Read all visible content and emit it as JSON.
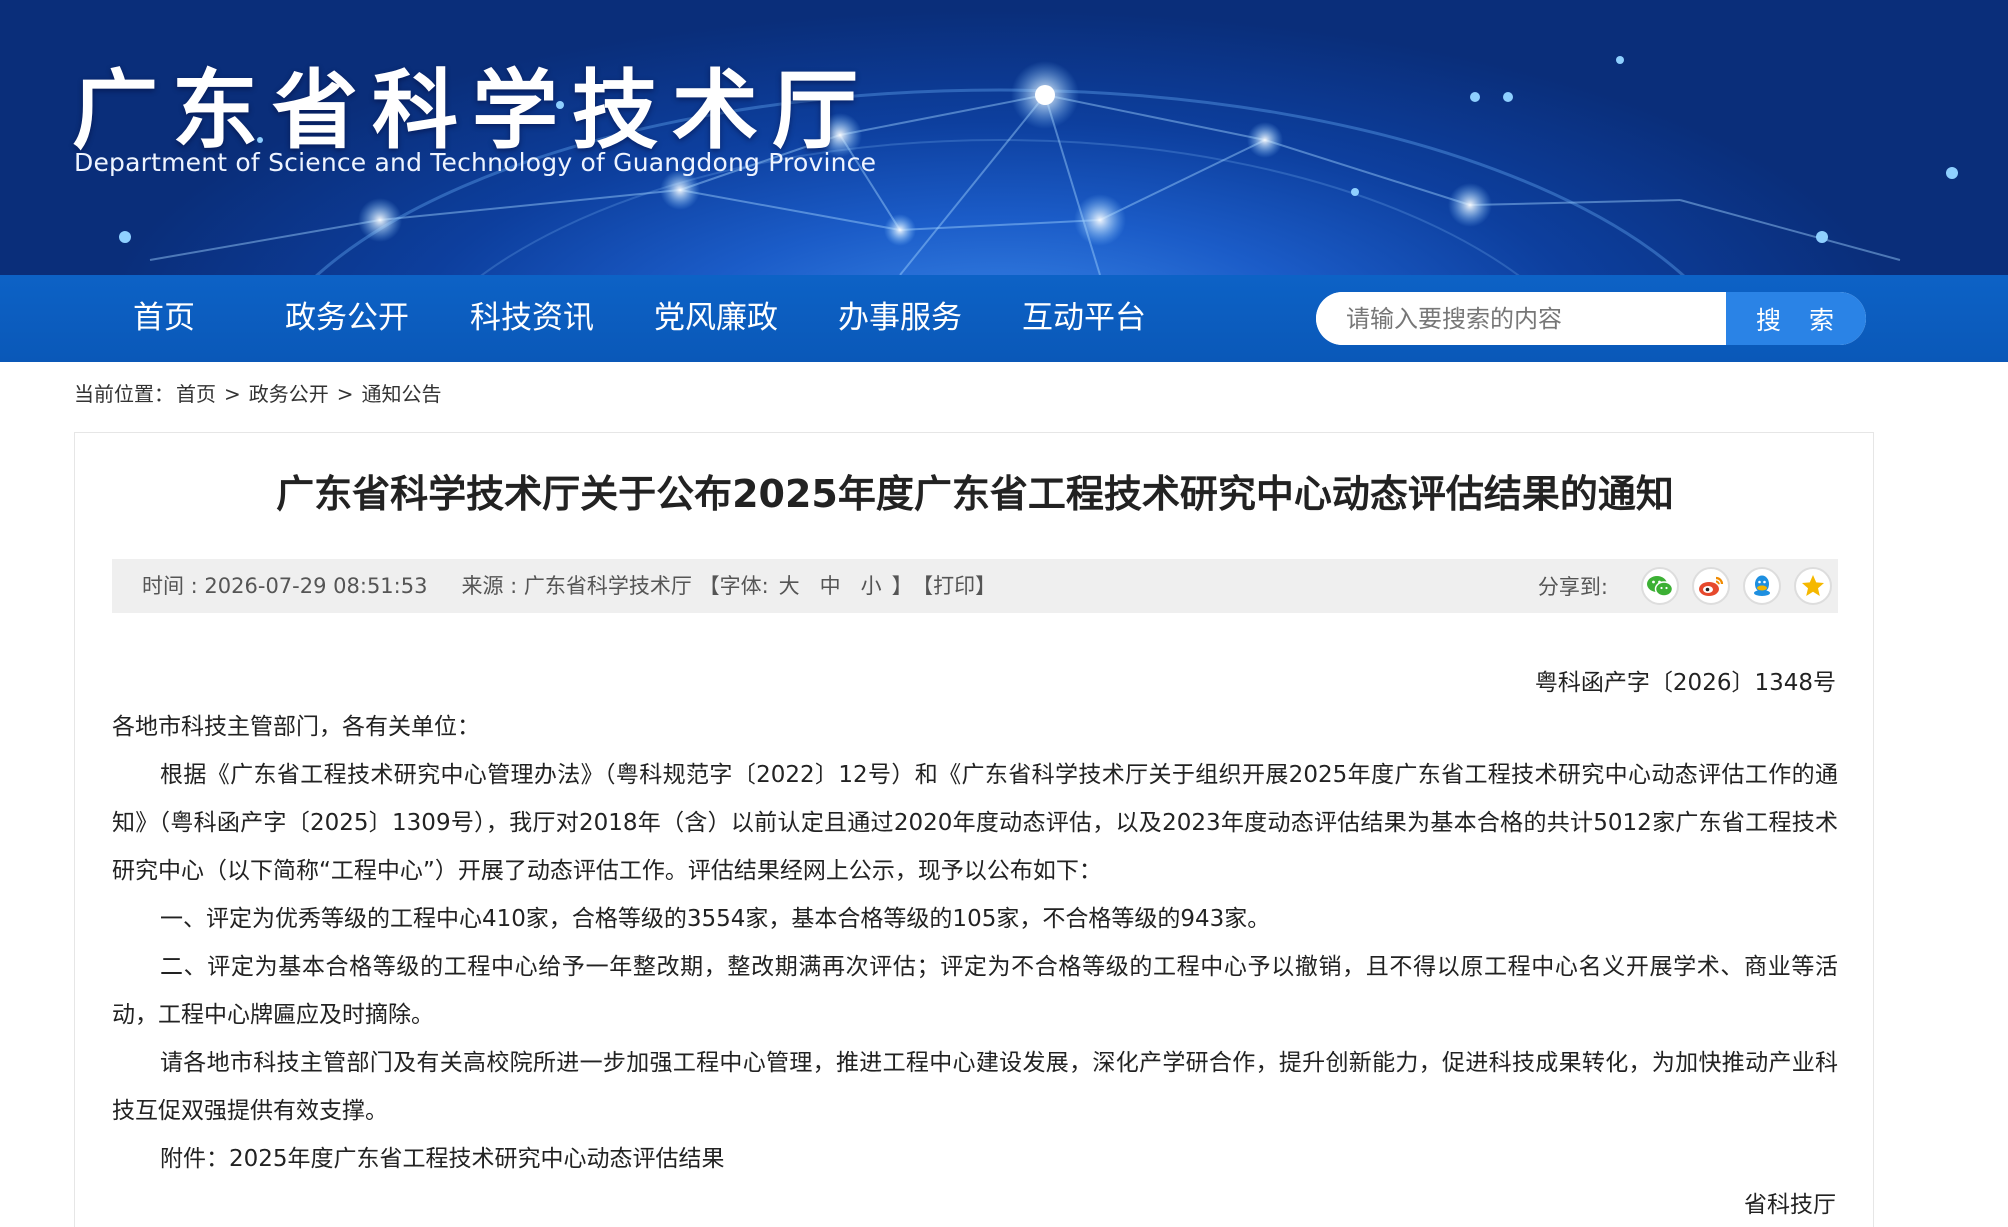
{
  "header": {
    "title": "广东省科学技术厅",
    "subtitle": "Department of Science and Technology of Guangdong Province"
  },
  "nav": {
    "items": [
      {
        "label": "首页"
      },
      {
        "label": "政务公开"
      },
      {
        "label": "科技资讯"
      },
      {
        "label": "党风廉政"
      },
      {
        "label": "办事服务"
      },
      {
        "label": "互动平台"
      }
    ]
  },
  "search": {
    "placeholder": "请输入要搜索的内容",
    "button_label": "搜 索"
  },
  "breadcrumb": {
    "prefix": "当前位置：",
    "items": [
      "首页",
      "政务公开",
      "通知公告"
    ],
    "separator": ">"
  },
  "article": {
    "title": "广东省科学技术厅关于公布2025年度广东省工程技术研究中心动态评估结果的通知",
    "meta": {
      "time": "时间 : 2026-07-29 08:51:53",
      "source": "来源 : 广东省科学技术厅",
      "font_prefix": "【字体:",
      "font_large": "大",
      "font_medium": "中",
      "font_small": "小",
      "font_suffix": "】",
      "print": "【打印】",
      "share_label": "分享到:"
    },
    "doc_number": "粤科函产字〔2026〕1348号",
    "salutation": "各地市科技主管部门，各有关单位：",
    "paragraphs": [
      "根据《广东省工程技术研究中心管理办法》（粤科规范字〔2022〕12号）和《广东省科学技术厅关于组织开展2025年度广东省工程技术研究中心动态评估工作的通知》（粤科函产字〔2025〕1309号），我厅对2018年（含）以前认定且通过2020年度动态评估，以及2023年度动态评估结果为基本合格的共计5012家广东省工程技术研究中心（以下简称“工程中心”）开展了动态评估工作。评估结果经网上公示，现予以公布如下：",
      "一、评定为优秀等级的工程中心410家，合格等级的3554家，基本合格等级的105家，不合格等级的943家。",
      "二、评定为基本合格等级的工程中心给予一年整改期，整改期满再次评估；评定为不合格等级的工程中心予以撤销，且不得以原工程中心名义开展学术、商业等活动，工程中心牌匾应及时摘除。",
      "请各地市科技主管部门及有关高校院所进一步加强工程中心管理，推进工程中心建设发展，深化产学研合作，提升创新能力，促进科技成果转化，为加快推动产业科技互促双强提供有效支撑。",
      "附件：2025年度广东省工程技术研究中心动态评估结果"
    ],
    "signature": "省科技厅"
  },
  "share_icons": [
    {
      "name": "wechat-icon",
      "color": "#3cb034"
    },
    {
      "name": "weibo-icon",
      "color": "#e6492d"
    },
    {
      "name": "qq-icon",
      "color": "#1e8fe0"
    },
    {
      "name": "qzone-icon",
      "color": "#f5b800"
    }
  ]
}
